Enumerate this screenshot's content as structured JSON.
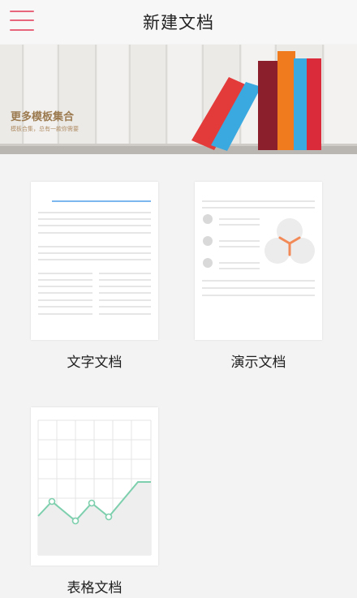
{
  "header": {
    "title": "新建文档"
  },
  "banner": {
    "title": "更多模板集合",
    "subtitle": "模板合集，总有一款你需要"
  },
  "documents": [
    {
      "label": "文字文档"
    },
    {
      "label": "演示文档"
    },
    {
      "label": "表格文档"
    }
  ],
  "colors": {
    "accent": "#e8667c",
    "background": "#f3f3f3",
    "doc_line_blue": "#7db7ef",
    "slide_accent": "#f28a57",
    "chart_line": "#7dcfad"
  }
}
